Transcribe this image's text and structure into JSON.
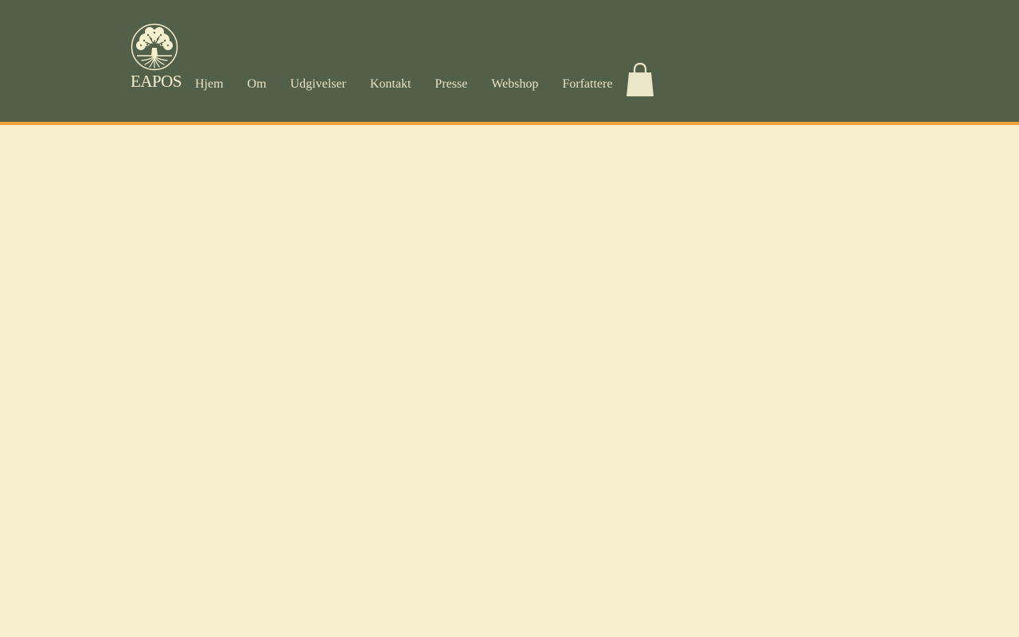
{
  "brand": {
    "name": "EAPOS",
    "icon": "tree-of-life-icon"
  },
  "nav": {
    "items": [
      {
        "label": "Hjem"
      },
      {
        "label": "Om"
      },
      {
        "label": "Udgivelser"
      },
      {
        "label": "Kontakt"
      },
      {
        "label": "Presse"
      },
      {
        "label": "Webshop"
      },
      {
        "label": "Forfattere"
      }
    ]
  },
  "cart": {
    "icon": "shopping-bag-icon"
  },
  "colors": {
    "header_bg": "#526049",
    "accent_line": "#f0a13a",
    "page_bg": "#f6f0cf",
    "nav_text": "#e8e2c4",
    "logo": "#f6f0cf"
  }
}
